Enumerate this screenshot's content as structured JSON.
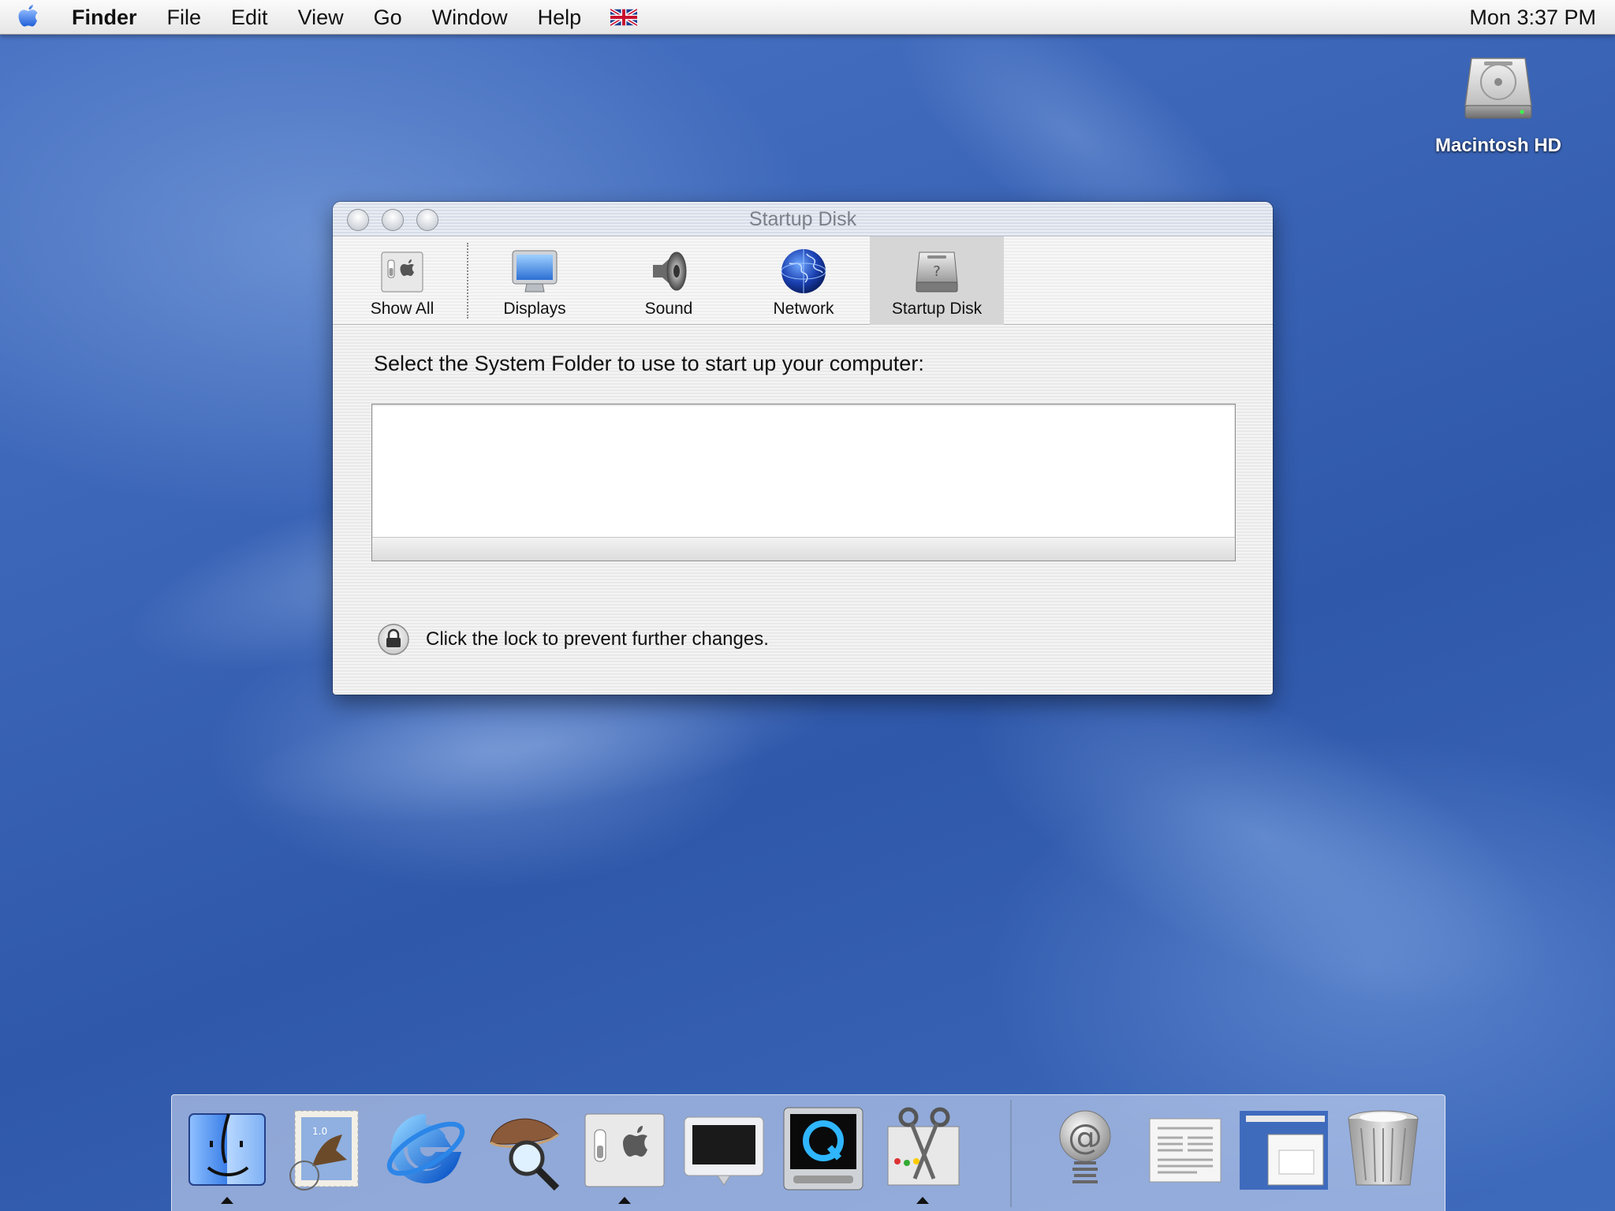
{
  "menubar": {
    "app_name": "Finder",
    "items": [
      "File",
      "Edit",
      "View",
      "Go",
      "Window",
      "Help"
    ],
    "clock": "Mon 3:37 PM",
    "keyboard_flag_icon": "uk-flag-icon"
  },
  "desktop": {
    "icons": [
      {
        "label": "Macintosh HD",
        "icon": "hard-disk-icon"
      }
    ]
  },
  "window": {
    "title": "Startup Disk",
    "toolbar": [
      {
        "label": "Show All",
        "icon": "system-preferences-icon"
      },
      {
        "label": "Displays",
        "icon": "display-icon"
      },
      {
        "label": "Sound",
        "icon": "speaker-icon"
      },
      {
        "label": "Network",
        "icon": "globe-icon"
      },
      {
        "label": "Startup Disk",
        "icon": "startup-disk-icon",
        "selected": true
      }
    ],
    "prompt": "Select the System Folder to use to start up your computer:",
    "lock_text": "Click the lock to prevent further changes."
  },
  "dock": {
    "items": [
      {
        "name": "finder",
        "icon": "finder-icon",
        "running": true
      },
      {
        "name": "mail",
        "icon": "mail-stamp-icon",
        "running": false
      },
      {
        "name": "internet-explorer",
        "icon": "internet-explorer-icon",
        "running": false
      },
      {
        "name": "sherlock",
        "icon": "sherlock-icon",
        "running": false
      },
      {
        "name": "system-preferences",
        "icon": "system-preferences-icon",
        "running": true
      },
      {
        "name": "display",
        "icon": "monitor-icon",
        "running": false
      },
      {
        "name": "quicktime",
        "icon": "quicktime-icon",
        "running": false
      },
      {
        "name": "grab",
        "icon": "scissors-icon",
        "running": true
      },
      {
        "name": "mail-docklet",
        "icon": "at-spring-icon",
        "running": false
      },
      {
        "name": "document",
        "icon": "newspaper-document-icon",
        "running": false
      },
      {
        "name": "minimized-window",
        "icon": "minimized-window-icon",
        "running": false
      },
      {
        "name": "trash",
        "icon": "trash-icon",
        "running": false
      }
    ]
  }
}
